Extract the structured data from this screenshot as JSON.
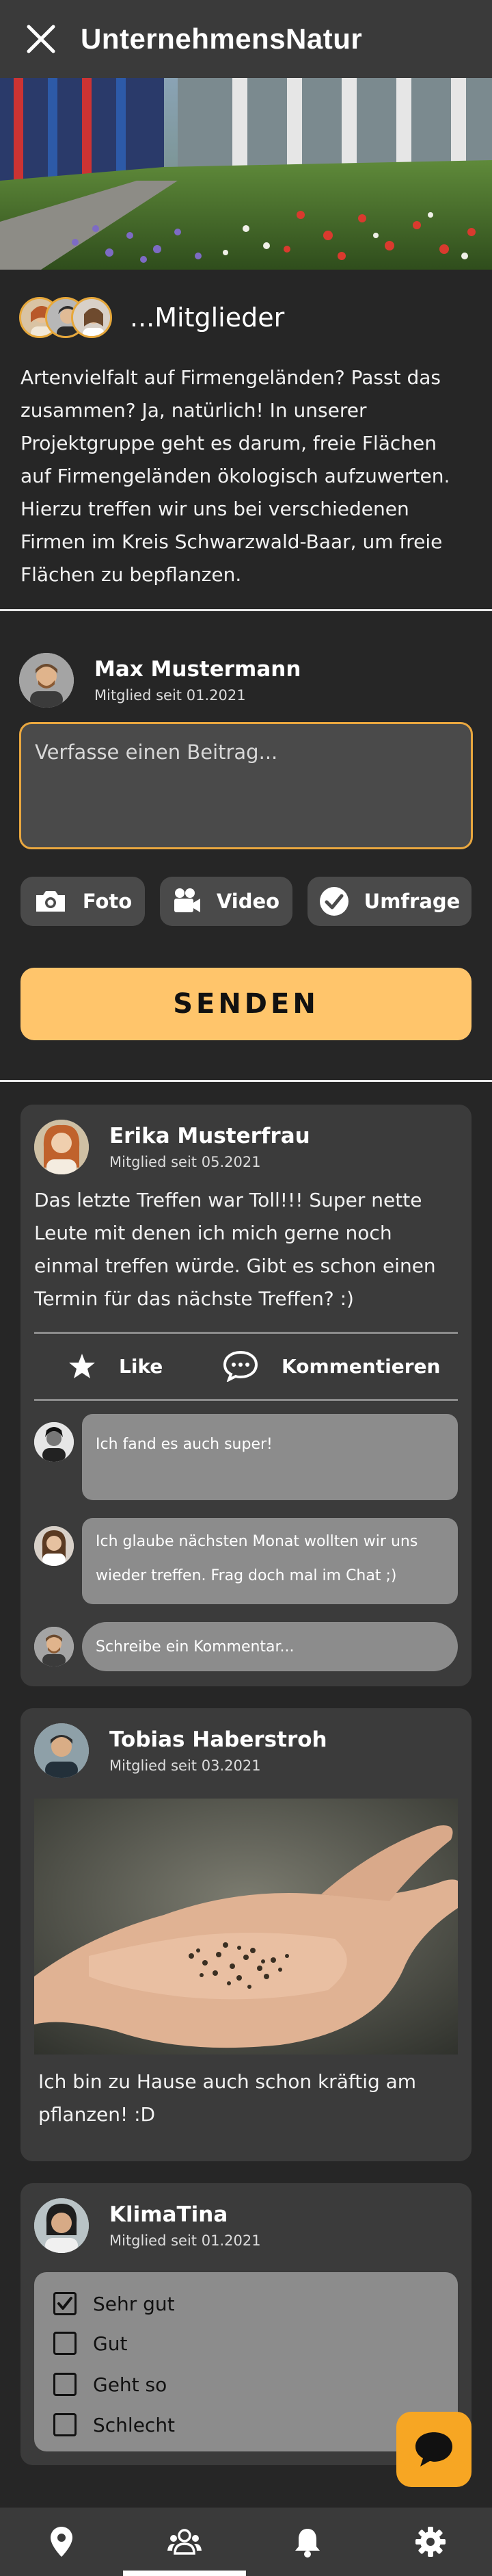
{
  "header": {
    "title": "UnternehmensNatur",
    "close_icon": "close-icon"
  },
  "group": {
    "members_label": "...Mitglieder",
    "description": "Artenvielfalt auf Firmengeländen? Passt das zusammen? Ja, natürlich! In unserer Projektgruppe geht es darum, freie Flächen auf Firmengeländen ökologisch aufzuwerten. Hierzu treffen wir uns bei verschiedenen Firmen im Kreis Schwarzwald-Baar, um freie Flächen zu bepflanzen."
  },
  "composer": {
    "user_name": "Max Mustermann",
    "member_since": "Mitglied seit 01.2021",
    "placeholder": "Verfasse einen Beitrag...",
    "photo_label": "Foto",
    "video_label": "Video",
    "poll_label": "Umfrage",
    "send_label": "SENDEN"
  },
  "posts": [
    {
      "author": "Erika Musterfrau",
      "member_since": "Mitglied seit 05.2021",
      "text": "Das letzte Treffen war Toll!!! Super nette Leute mit denen ich mich gerne noch einmal treffen würde. Gibt es schon einen Termin für das nächste Treffen? :)",
      "like_label": "Like",
      "comment_label": "Kommentieren",
      "comments": [
        {
          "text": "Ich fand es auch super!"
        },
        {
          "text": "Ich glaube nächsten Monat wollten wir uns wieder treffen. Frag doch mal im Chat ;)"
        }
      ],
      "comment_placeholder": "Schreibe ein Kommentar..."
    },
    {
      "author": "Tobias Haberstroh",
      "member_since": "Mitglied seit 03.2021",
      "text": "Ich bin zu Hause auch schon kräftig am pflanzen! :D"
    },
    {
      "author": "KlimaTina",
      "member_since": "Mitglied seit 01.2021",
      "poll_options": [
        {
          "label": "Sehr gut",
          "checked": true
        },
        {
          "label": "Gut",
          "checked": false
        },
        {
          "label": "Geht so",
          "checked": false
        },
        {
          "label": "Schlecht",
          "checked": false
        }
      ]
    }
  ],
  "fab": {
    "icon": "chat-bubble-icon"
  },
  "bottom_nav": {
    "items": [
      "location-pin-icon",
      "group-icon",
      "bell-icon",
      "gear-icon"
    ],
    "active_index": 1
  },
  "colors": {
    "accent_orange": "#f7a623",
    "send_button": "#ffc56b",
    "input_border": "#e9a73f",
    "card_bg": "#3b3b3b",
    "page_bg": "#262626"
  }
}
